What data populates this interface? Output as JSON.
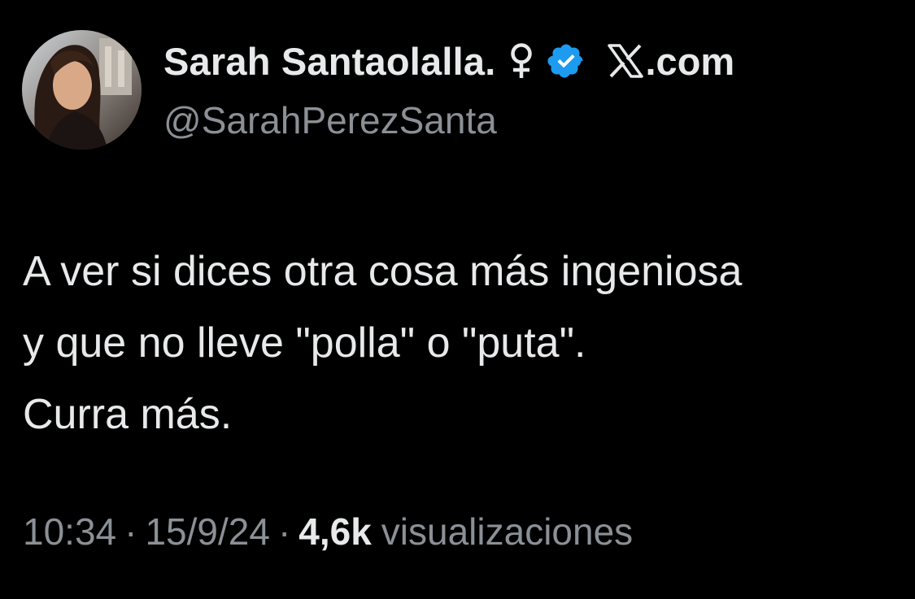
{
  "tweet": {
    "author": {
      "display_name": "Sarah Santaolalla.",
      "handle": "@SarahPerezSanta",
      "gender_icon": "female-symbol-icon",
      "verified_icon": "verified-badge-icon",
      "avatar": "profile-photo"
    },
    "brand": {
      "logo_icon": "x-logo-icon",
      "label": ".com"
    },
    "text_lines": [
      "A ver si dices otra cosa más ingeniosa",
      "y que no lleve \"polla\" o \"puta\".",
      "Curra más."
    ],
    "meta": {
      "time": "10:34",
      "date": "15/9/24",
      "separator": "·",
      "views_count": "4,6k",
      "views_label": "visualizaciones"
    },
    "colors": {
      "background": "#000000",
      "primary_text": "#e7e9ea",
      "secondary_text": "#8b9096",
      "verified_blue": "#1d9bf0"
    }
  }
}
